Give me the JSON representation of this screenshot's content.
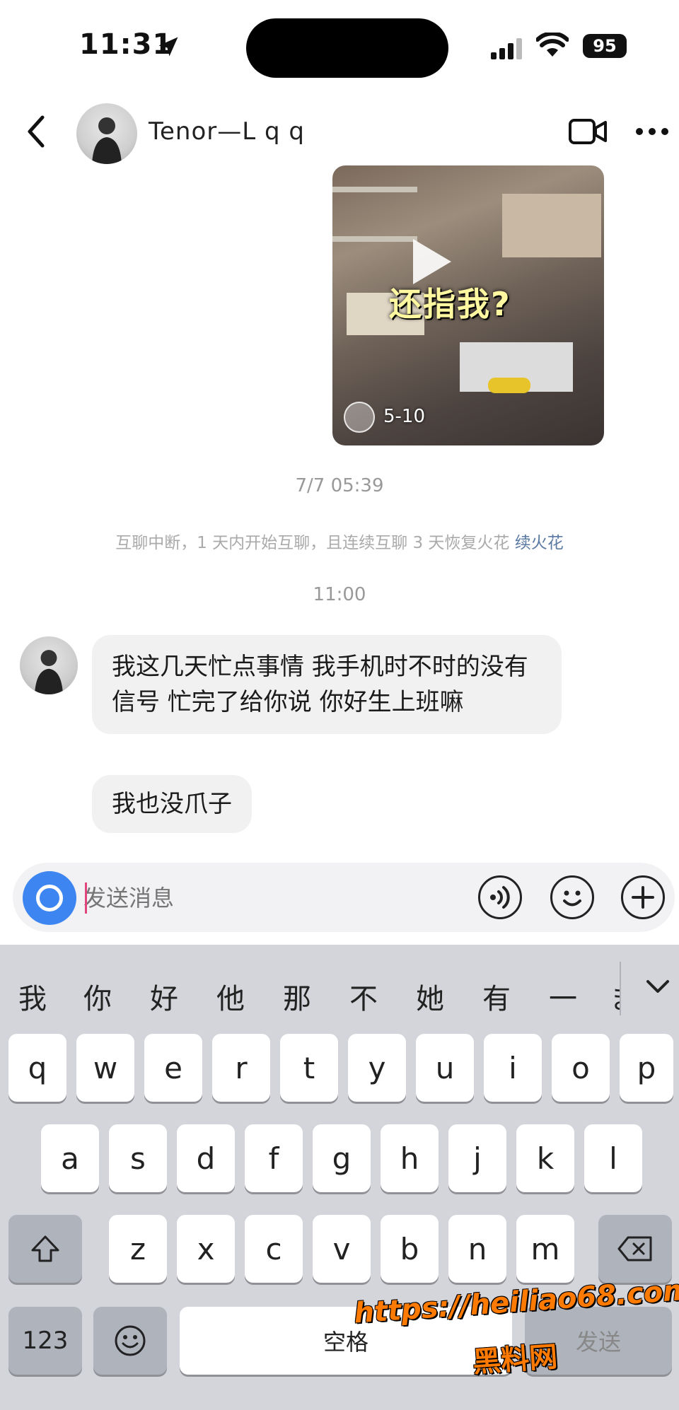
{
  "status_bar": {
    "time": "11:31",
    "battery": "95"
  },
  "header": {
    "contact_name": "Tenor—L q q",
    "icons": [
      "back-icon",
      "video-call-icon",
      "more-icon"
    ]
  },
  "video_card": {
    "caption": "还指我?",
    "duration": "5-10"
  },
  "conversation": {
    "timestamp_1": "7/7 05:39",
    "streak_notice": "互聊中断，1 天内开始互聊，且连续互聊 3 天恢复火花",
    "streak_link": "续火花",
    "timestamp_2": "11:00",
    "messages": [
      {
        "text": "我这几天忙点事情 我手机时不时的没有信号 忙完了给你说 你好生上班嘛"
      },
      {
        "text": "我也没爪子"
      }
    ]
  },
  "composer": {
    "placeholder": "发送消息",
    "icons": [
      "camera-icon",
      "voice-icon",
      "emoji-icon",
      "plus-icon"
    ]
  },
  "keyboard": {
    "candidates": [
      "我",
      "你",
      "好",
      "他",
      "那",
      "不",
      "她",
      "有",
      "一",
      "ま"
    ],
    "row1": [
      "q",
      "w",
      "e",
      "r",
      "t",
      "y",
      "u",
      "i",
      "o",
      "p"
    ],
    "row2": [
      "a",
      "s",
      "d",
      "f",
      "g",
      "h",
      "j",
      "k",
      "l"
    ],
    "row3": [
      "z",
      "x",
      "c",
      "v",
      "b",
      "n",
      "m"
    ],
    "num_key": "123",
    "space_label": "空格",
    "send_label": "发送"
  },
  "watermark": {
    "url": "https://heiliao68.com",
    "name": "黑料网"
  },
  "colors": {
    "accent_blue": "#3d86f2",
    "streak_link": "#5b7aa3",
    "caret": "#e0457b",
    "keyboard_bg": "#d3d5db"
  }
}
